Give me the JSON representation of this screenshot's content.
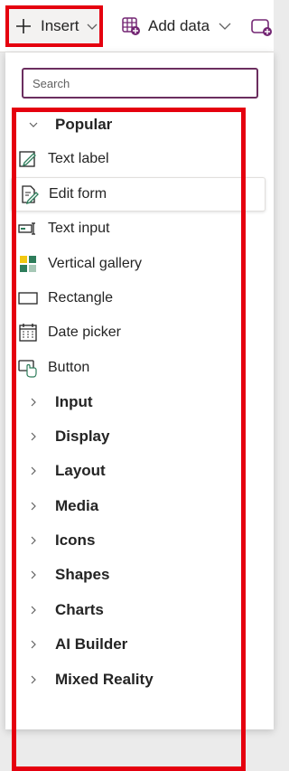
{
  "toolbar": {
    "insert_label": "Insert",
    "add_data_label": "Add data"
  },
  "search": {
    "placeholder": "Search",
    "value": ""
  },
  "popular": {
    "label": "Popular",
    "items": [
      {
        "label": "Text label",
        "icon": "text-label-icon"
      },
      {
        "label": "Edit form",
        "icon": "edit-form-icon"
      },
      {
        "label": "Text input",
        "icon": "text-input-icon"
      },
      {
        "label": "Vertical gallery",
        "icon": "vertical-gallery-icon"
      },
      {
        "label": "Rectangle",
        "icon": "rectangle-icon"
      },
      {
        "label": "Date picker",
        "icon": "date-picker-icon"
      },
      {
        "label": "Button",
        "icon": "button-icon"
      }
    ]
  },
  "categories": [
    "Input",
    "Display",
    "Layout",
    "Media",
    "Icons",
    "Shapes",
    "Charts",
    "AI Builder",
    "Mixed Reality"
  ],
  "colors": {
    "highlight": "#e5000f",
    "accent": "#742774",
    "icon_green": "#2e7d5b"
  }
}
